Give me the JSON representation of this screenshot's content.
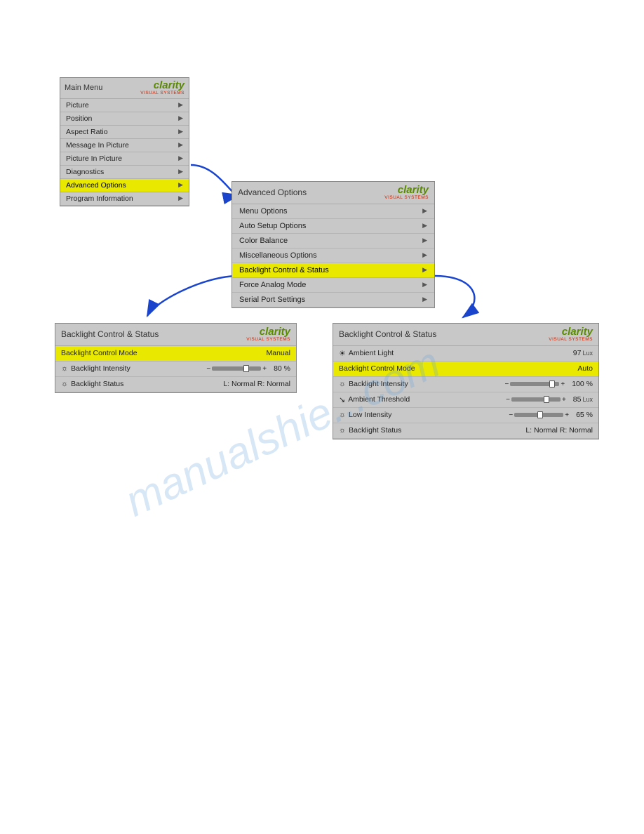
{
  "mainMenu": {
    "title": "Main Menu",
    "items": [
      {
        "label": "Picture",
        "hasArrow": true,
        "highlighted": false
      },
      {
        "label": "Position",
        "hasArrow": true,
        "highlighted": false
      },
      {
        "label": "Aspect Ratio",
        "hasArrow": true,
        "highlighted": false
      },
      {
        "label": "Message In Picture",
        "hasArrow": true,
        "highlighted": false
      },
      {
        "label": "Picture In Picture",
        "hasArrow": true,
        "highlighted": false
      },
      {
        "label": "Diagnostics",
        "hasArrow": true,
        "highlighted": false
      },
      {
        "label": "Advanced Options",
        "hasArrow": true,
        "highlighted": true
      },
      {
        "label": "Program Information",
        "hasArrow": true,
        "highlighted": false
      }
    ]
  },
  "advancedMenu": {
    "title": "Advanced Options",
    "items": [
      {
        "label": "Menu Options",
        "hasArrow": true,
        "highlighted": false
      },
      {
        "label": "Auto Setup Options",
        "hasArrow": true,
        "highlighted": false
      },
      {
        "label": "Color Balance",
        "hasArrow": true,
        "highlighted": false
      },
      {
        "label": "Miscellaneous Options",
        "hasArrow": true,
        "highlighted": false
      },
      {
        "label": "Backlight Control & Status",
        "hasArrow": true,
        "highlighted": true
      },
      {
        "label": "Force Analog Mode",
        "hasArrow": true,
        "highlighted": false
      },
      {
        "label": "Serial Port Settings",
        "hasArrow": true,
        "highlighted": false
      }
    ]
  },
  "backlightManual": {
    "title": "Backlight Control & Status",
    "rows": [
      {
        "type": "highlighted",
        "icon": "",
        "label": "Backlight Control Mode",
        "value": "Manual",
        "sliderPos": null,
        "unit": ""
      },
      {
        "type": "normal",
        "icon": "bulb",
        "label": "Backlight Intensity",
        "slider": true,
        "sliderPos": 65,
        "value": "80 %",
        "unit": ""
      },
      {
        "type": "normal",
        "icon": "bulb",
        "label": "Backlight Status",
        "value": "L:  Normal  R:  Normal",
        "slider": false,
        "unit": ""
      }
    ]
  },
  "backlightAuto": {
    "title": "Backlight Control & Status",
    "rows": [
      {
        "type": "normal",
        "icon": "sun",
        "label": "Ambient Light",
        "value": "97",
        "unit": "Lux",
        "slider": false
      },
      {
        "type": "highlighted",
        "icon": "",
        "label": "Backlight Control Mode",
        "value": "Auto",
        "unit": "",
        "slider": false
      },
      {
        "type": "normal",
        "icon": "bulb",
        "label": "Backlight Intensity",
        "slider": true,
        "sliderPos": 80,
        "value": "100 %",
        "unit": ""
      },
      {
        "type": "normal",
        "icon": "ambient",
        "label": "Ambient Threshold",
        "slider": true,
        "sliderPos": 68,
        "value": "85",
        "unit": "Lux"
      },
      {
        "type": "normal",
        "icon": "bulb",
        "label": "Low Intensity",
        "slider": true,
        "sliderPos": 50,
        "value": "65 %",
        "unit": ""
      },
      {
        "type": "normal",
        "icon": "bulb",
        "label": "Backlight Status",
        "value": "L:  Normal  R:  Normal",
        "slider": false,
        "unit": ""
      }
    ]
  },
  "watermark": "manualshie...com",
  "colors": {
    "highlight": "#e8e800",
    "menuBg": "#c8c8c8",
    "arrowBlue": "#1144cc"
  }
}
